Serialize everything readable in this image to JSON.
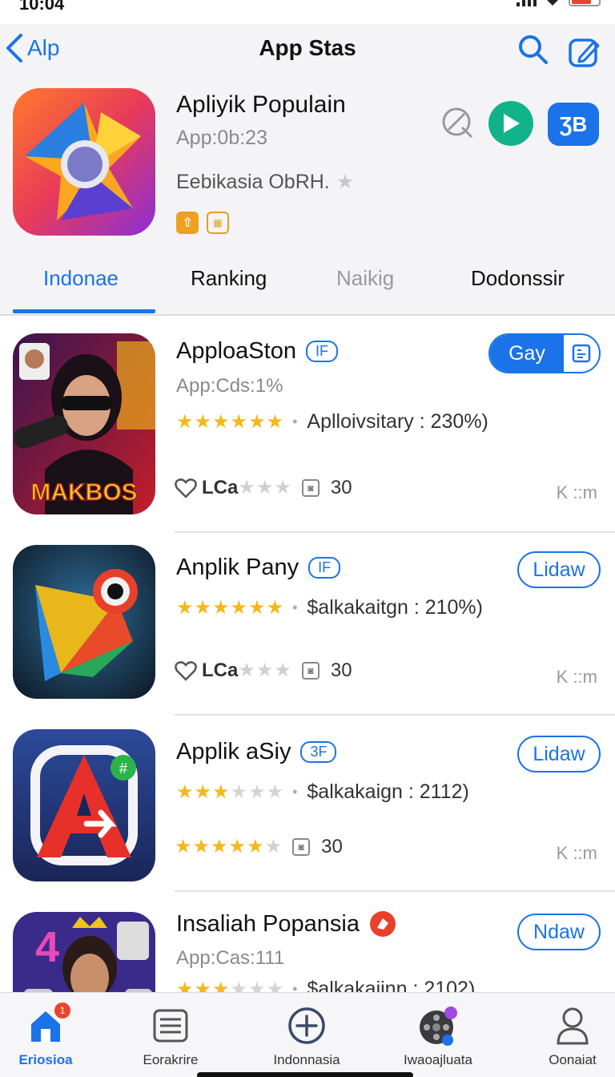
{
  "status_bar": {
    "time": "10:04"
  },
  "nav": {
    "back_label": "Alp",
    "title": "App Stas"
  },
  "hero": {
    "title": "Apliyik Populain",
    "subtitle": "App:0b:23",
    "developer": "Eebikasia ObRH.",
    "action_label": "ƷB"
  },
  "tabs": [
    "Indonae",
    "Ranking",
    "Naikig",
    "Dodonssir"
  ],
  "apps": [
    {
      "name": "ApploaSton",
      "tag": "IF",
      "sub": "App:Cds:1%",
      "rating": 5,
      "meta": "Aplloivsitary : 230%)",
      "foot_label": "LCa",
      "foot_count": "30",
      "kr": "K ::m",
      "button": "Gay",
      "icon_text": "MAKBOS"
    },
    {
      "name": "Anplik Pany",
      "tag": "IF",
      "sub": "",
      "rating": 5,
      "meta": "$alkakaitgn : 210%)",
      "foot_label": "LCa",
      "foot_count": "30",
      "kr": "K ::m",
      "button": "Lidaw"
    },
    {
      "name": "Applik aSiy",
      "tag": "3F",
      "sub": "",
      "rating": 3,
      "meta": "$alkakaign : 2112)",
      "foot_label": "",
      "foot_count": "30",
      "kr": "K ::m",
      "button": "Lidaw",
      "foot_rating": 4
    },
    {
      "name": "Insaliah Popansia",
      "tag": "",
      "sub": "App:Cas:111",
      "rating": 3,
      "meta": "$alkakaijnn : 2102)",
      "button": "Ndaw"
    }
  ],
  "tabbar": [
    {
      "label": "Eriosioa",
      "icon": "home-icon",
      "badge": "1"
    },
    {
      "label": "Eorakrire",
      "icon": "list-icon"
    },
    {
      "label": "Indonnasia",
      "icon": "plus-circle-icon"
    },
    {
      "label": "Iwaoajluata",
      "icon": "film-reel-icon"
    },
    {
      "label": "Oonaiat",
      "icon": "person-icon"
    }
  ],
  "colors": {
    "accent": "#1a73e8",
    "star": "#f5b81c",
    "play": "#11b38a"
  }
}
